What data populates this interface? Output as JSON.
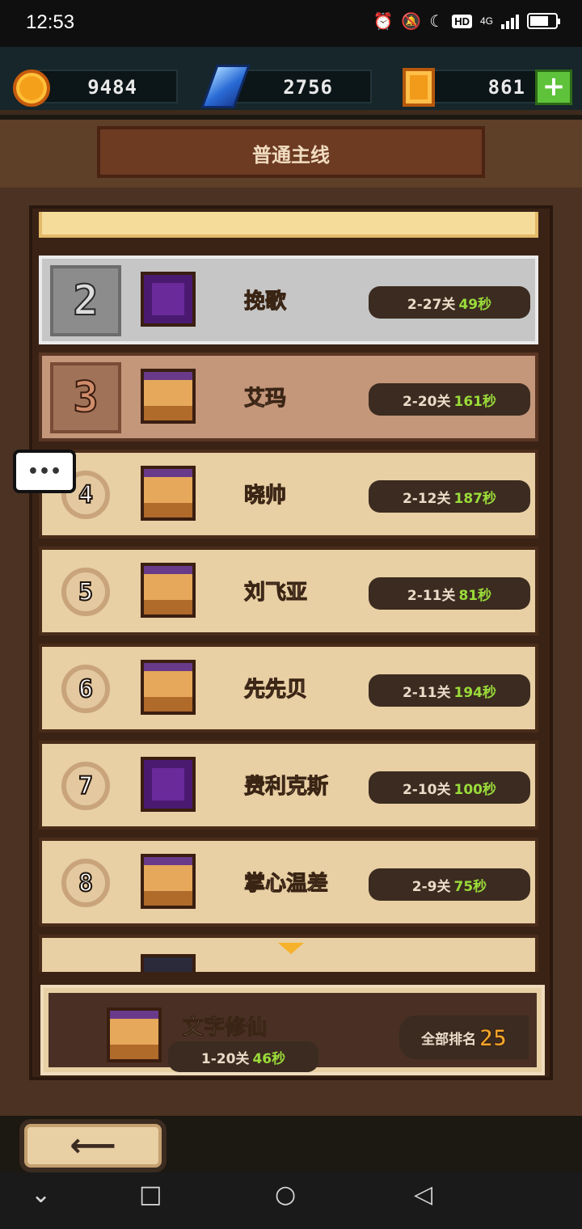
{
  "status_bar": {
    "time": "12:53",
    "hd_label": "HD",
    "net_label": "4G"
  },
  "currency": {
    "coins": "9484",
    "gems": "2756",
    "tokens": "861",
    "plus_label": "+"
  },
  "banner": {
    "title": "普通主线"
  },
  "leaderboard": [
    {
      "rank": "2",
      "name": "挽歌",
      "stage": "2-27关",
      "seconds": "49秒"
    },
    {
      "rank": "3",
      "name": "艾玛",
      "stage": "2-20关",
      "seconds": "161秒"
    },
    {
      "rank": "4",
      "name": "晓帅",
      "stage": "2-12关",
      "seconds": "187秒"
    },
    {
      "rank": "5",
      "name": "刘飞亚",
      "stage": "2-11关",
      "seconds": "81秒"
    },
    {
      "rank": "6",
      "name": "先先贝",
      "stage": "2-11关",
      "seconds": "194秒"
    },
    {
      "rank": "7",
      "name": "费利克斯",
      "stage": "2-10关",
      "seconds": "100秒"
    },
    {
      "rank": "8",
      "name": "掌心温差",
      "stage": "2-9关",
      "seconds": "75秒"
    }
  ],
  "self": {
    "name": "文字修仙",
    "stage": "1-20关",
    "seconds": "46秒",
    "rank_label": "全部排名",
    "rank_value": "25"
  },
  "chat": {
    "label": "•••"
  },
  "back_button": {
    "label": "⟵"
  },
  "nav": {
    "down": "⌄",
    "home": "□",
    "circle": "○",
    "back": "◁"
  }
}
